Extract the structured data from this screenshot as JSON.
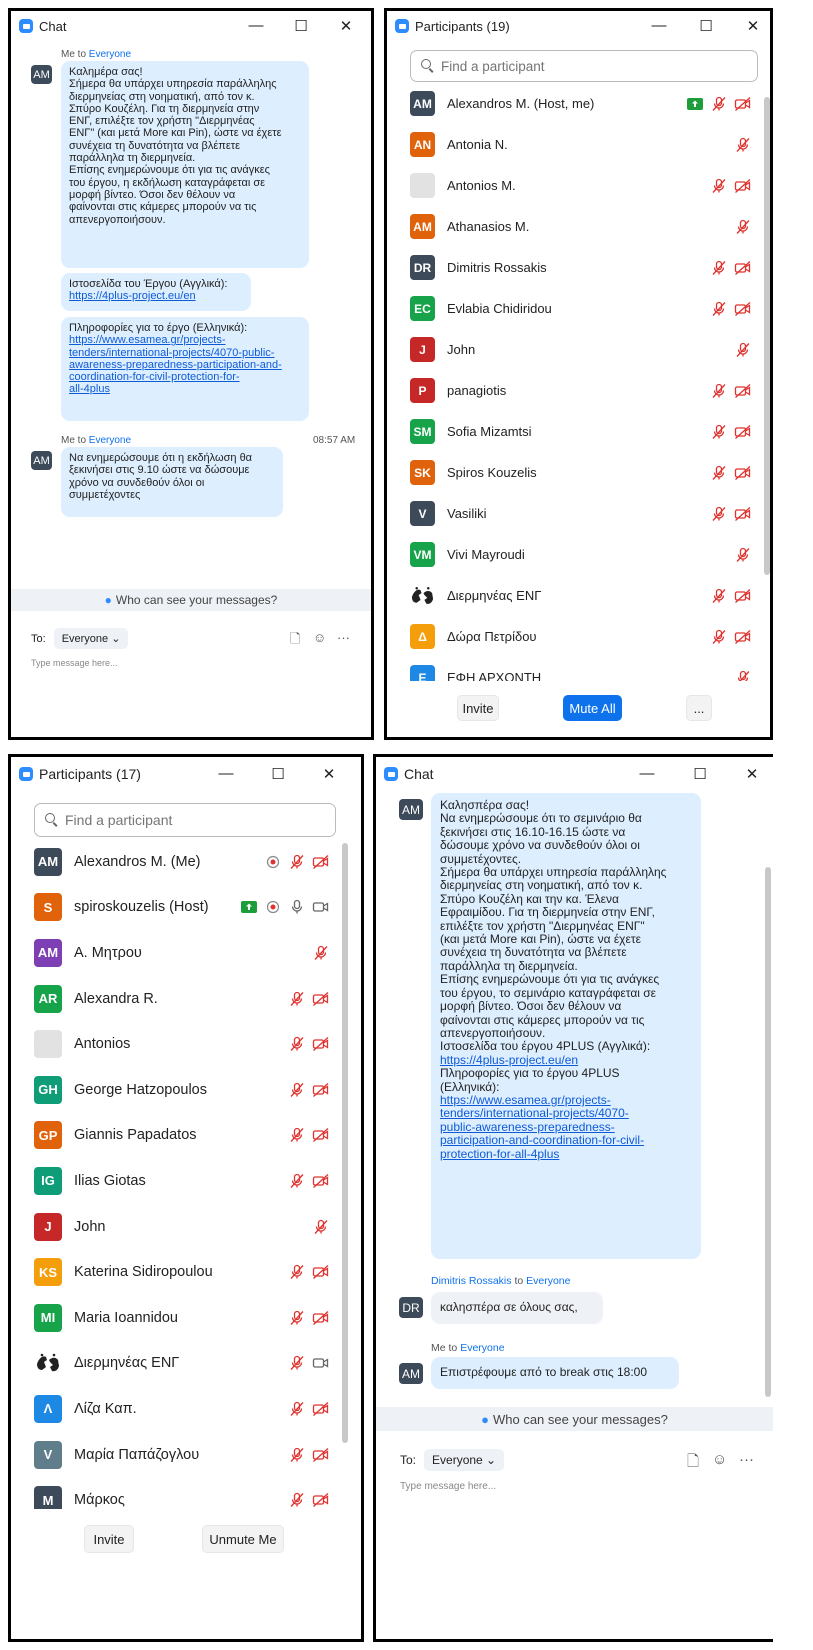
{
  "chat1": {
    "title": "Chat",
    "msg1": {
      "meta_prefix": "Me to",
      "meta_to": "Everyone",
      "avatar": "AM",
      "b1": [
        "Καλημέρα σας!",
        "Σήμερα θα υπάρχει υπηρεσία παράλληλης",
        "διερμηνείας στη νοηματική, από τον κ.",
        "Σπύρο Κουζέλη. Για τη διερμηνεία στην",
        "ΕΝΓ, επιλέξτε τον χρήστη \"Διερμηνέας",
        "ΕΝΓ\" (και μετά More και Pin), ώστε να έχετε",
        "συνέχεια τη δυνατότητα να βλέπετε",
        "παράλληλα τη διερμηνεία.",
        "Επίσης ενημερώνουμε ότι για τις ανάγκες",
        "του έργου, η εκδήλωση καταγράφεται σε",
        "μορφή βίντεο. Όσοι δεν θέλουν να",
        "φαίνονται στις κάμερες μπορούν να τις",
        "απενεργοποιήσουν."
      ],
      "b2_text": "Ιστοσελίδα του Έργου (Αγγλικά):",
      "b2_link": "https://4plus-project.eu/en",
      "b3_text": "Πληροφορίες για το έργο (Ελληνικά):",
      "b3_link": [
        "https://www.esamea.gr/projects-",
        "tenders/international-projects/4070-public-",
        "awareness-preparedness-participation-and-",
        "coordination-for-civil-protection-for-",
        "all-4plus"
      ]
    },
    "msg2": {
      "meta_prefix": "Me to",
      "meta_to": "Everyone",
      "time": "08:57 AM",
      "avatar": "AM",
      "b1": [
        "Να ενημερώσουμε ότι η εκδήλωση θα",
        "ξεκινήσει στις 9.10 ώστε να δώσουμε",
        "χρόνο να συνδεθούν όλοι οι",
        "συμμετέχοντες"
      ]
    },
    "who_can_see": "Who can see your messages?",
    "to_label": "To:",
    "recipient": "Everyone",
    "placeholder": "Type message here..."
  },
  "participants1": {
    "title": "Participants (19)",
    "search_placeholder": "Find a participant",
    "rows": [
      {
        "av": "AM",
        "color": "#3d4a5a",
        "name": "Alexandros M. (Host, me)",
        "icons": "share,mic,vid"
      },
      {
        "av": "AN",
        "color": "#E0620A",
        "name": "Antonia N.",
        "icons": "mic"
      },
      {
        "av": "",
        "color": "#e2e2e2",
        "name": "Antonios M.",
        "icons": "mic,vid"
      },
      {
        "av": "AM",
        "color": "#E0620A",
        "name": "Athanasios M.",
        "icons": "mic"
      },
      {
        "av": "DR",
        "color": "#3d4a5a",
        "name": "Dimitris Rossakis",
        "icons": "mic,vid"
      },
      {
        "av": "EC",
        "color": "#16A34A",
        "name": "Evlabia Chidiridou",
        "icons": "mic,vid"
      },
      {
        "av": "J",
        "color": "#C62828",
        "name": "John",
        "icons": "mic"
      },
      {
        "av": "P",
        "color": "#C62828",
        "name": "panagiotis",
        "icons": "mic,vid"
      },
      {
        "av": "SM",
        "color": "#16A34A",
        "name": "Sofia Mizamtsi",
        "icons": "mic,vid"
      },
      {
        "av": "SK",
        "color": "#E0620A",
        "name": "Spiros Kouzelis",
        "icons": "mic,vid"
      },
      {
        "av": "V",
        "color": "#3d4a5a",
        "name": "Vasiliki",
        "icons": "mic,vid"
      },
      {
        "av": "VM",
        "color": "#16A34A",
        "name": "Vivi Mayroudi",
        "icons": "mic"
      },
      {
        "av": "sign",
        "color": "transparent",
        "name": "Διερμηνέας ΕΝΓ",
        "icons": "mic,vid"
      },
      {
        "av": "Δ",
        "color": "#F59E0B",
        "name": "Δώρα Πετρίδου",
        "icons": "mic,vid"
      },
      {
        "av": "Ε",
        "color": "#1E88E5",
        "name": "ΕΦΗ ΑΡΧΟΝΤΗ",
        "icons": "mic"
      }
    ],
    "invite": "Invite",
    "mute_all": "Mute All",
    "more": "..."
  },
  "participants2": {
    "title": "Participants (17)",
    "search_placeholder": "Find a participant",
    "rows": [
      {
        "av": "AM",
        "color": "#3d4a5a",
        "name": "Alexandros M. (Me)",
        "icons": "rec,mic,vid"
      },
      {
        "av": "S",
        "color": "#E0620A",
        "name": "spiroskouzelis (Host)",
        "icons": "share,rec,micon,vidon"
      },
      {
        "av": "AM",
        "color": "#7E3FB5",
        "name": "Α. Μητρου",
        "icons": "mic"
      },
      {
        "av": "AR",
        "color": "#16A34A",
        "name": "Alexandra R.",
        "icons": "mic,vid"
      },
      {
        "av": "",
        "color": "#e2e2e2",
        "name": "Antonios",
        "icons": "mic,vid"
      },
      {
        "av": "GH",
        "color": "#0F9D78",
        "name": "George Hatzopoulos",
        "icons": "mic,vid"
      },
      {
        "av": "GP",
        "color": "#E0620A",
        "name": "Giannis Papadatos",
        "icons": "mic,vid"
      },
      {
        "av": "IG",
        "color": "#0F9D78",
        "name": "Ilias Giotas",
        "icons": "mic,vid"
      },
      {
        "av": "J",
        "color": "#C62828",
        "name": "John",
        "icons": "mic"
      },
      {
        "av": "KS",
        "color": "#F59E0B",
        "name": "Katerina Sidiropoulou",
        "icons": "mic,vid"
      },
      {
        "av": "MI",
        "color": "#16A34A",
        "name": "Maria Ioannidou",
        "icons": "mic,vid"
      },
      {
        "av": "sign",
        "color": "transparent",
        "name": "Διερμηνέας ΕΝΓ",
        "icons": "mic,vidon"
      },
      {
        "av": "Λ",
        "color": "#1E88E5",
        "name": "Λίζα Καπ.",
        "icons": "mic,vid"
      },
      {
        "av": "V",
        "color": "#607D8B",
        "name": "Μαρία Παπάζογλου",
        "icons": "mic,vid"
      },
      {
        "av": "M",
        "color": "#3d4a5a",
        "name": "Μάρκος",
        "icons": "mic,vid"
      }
    ],
    "invite": "Invite",
    "unmute_me": "Unmute Me"
  },
  "chat2": {
    "title": "Chat",
    "avatar": "AM",
    "b1_text": [
      "Καλησπέρα σας!",
      "Να ενημερώσουμε ότι το σεμινάριο θα",
      "ξεκινήσει στις 16.10-16.15 ώστε να",
      "δώσουμε χρόνο να συνδεθούν όλοι οι",
      "συμμετέχοντες.",
      "Σήμερα θα υπάρχει υπηρεσία παράλληλης",
      "διερμηνείας στη νοηματική, από τον κ.",
      "Σπύρο Κουζέλη και την κα. Έλενα",
      "Εφραιμίδου. Για τη διερμηνεία στην ΕΝΓ,",
      "επιλέξτε τον χρήστη \"Διερμηνέας ΕΝΓ\"",
      "(και μετά More και Pin), ώστε να έχετε",
      "συνέχεια τη δυνατότητα να βλέπετε",
      "παράλληλα τη διερμηνεία.",
      "Επίσης ενημερώνουμε ότι για τις ανάγκες",
      "του έργου, το σεμινάριο καταγράφεται σε",
      "μορφή βίντεο. Όσοι δεν θέλουν να",
      "φαίνονται στις κάμερες μπορούν να τις",
      "απενεργοποιήσουν.",
      "Ιστοσελίδα του έργου 4PLUS (Αγγλικά):"
    ],
    "b1_link1": "https://4plus-project.eu/en",
    "b1_text2": [
      "Πληροφορίες για το έργου 4PLUS",
      "(Ελληνικά):"
    ],
    "b1_link2": [
      "https://www.esamea.gr/projects-",
      "tenders/international-projects/4070-",
      "public-awareness-preparedness-",
      "participation-and-coordination-for-civil-",
      "protection-for-all-4plus"
    ],
    "msg2_sender": "Dimitris Rossakis",
    "msg2_to_prefix": "to",
    "msg2_to": "Everyone",
    "msg2_avatar": "DR",
    "msg2_text": "καλησπέρα σε όλους σας,",
    "msg3_prefix": "Me to",
    "msg3_to": "Everyone",
    "msg3_avatar": "AM",
    "msg3_text": "Επιστρέφουμε από το break στις 18:00",
    "who_can_see": "Who can see your messages?",
    "to_label": "To:",
    "recipient": "Everyone",
    "placeholder": "Type message here..."
  }
}
